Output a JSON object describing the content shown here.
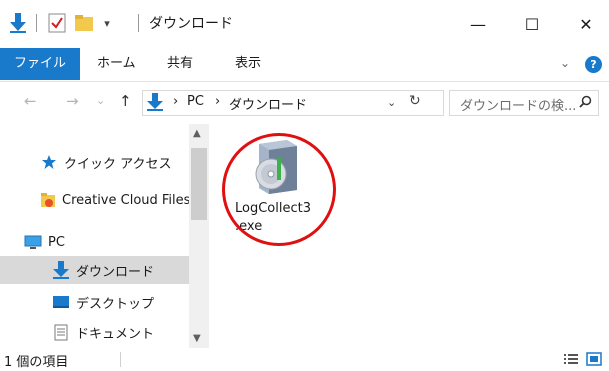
{
  "window": {
    "title": "ダウンロード",
    "minimize_glyph": "—",
    "maximize_glyph": "☐",
    "close_glyph": "✕",
    "accent_color": "#1979ca",
    "folder_color": "#f2c94c"
  },
  "ribbon": {
    "tabs": [
      {
        "label": "ファイル"
      },
      {
        "label": "ホーム"
      },
      {
        "label": "共有"
      },
      {
        "label": "表示"
      }
    ],
    "expand_glyph": "⌄",
    "help_glyph": "?"
  },
  "address": {
    "crumbs": [
      "PC",
      "ダウンロード"
    ],
    "separator": "›",
    "dropdown_glyph": "⌄",
    "refresh_glyph": "↻"
  },
  "search": {
    "placeholder": "ダウンロードの検..."
  },
  "nav": {
    "back_glyph": "←",
    "forward_glyph": "→",
    "recent_glyph": "⌄",
    "up_glyph": "↑",
    "items": [
      {
        "label": "クイック アクセス",
        "icon": "star-icon"
      },
      {
        "label": "Creative Cloud Files",
        "icon": "creative-cloud-icon"
      },
      {
        "label": "PC",
        "icon": "pc-icon"
      },
      {
        "label": "ダウンロード",
        "icon": "download-arrow-icon",
        "selected": true
      },
      {
        "label": "デスクトップ",
        "icon": "desktop-icon"
      },
      {
        "label": "ドキュメント",
        "icon": "document-icon"
      }
    ],
    "scroll_up_glyph": "▲",
    "scroll_down_glyph": "▼"
  },
  "content": {
    "files": [
      {
        "name": "LogCollect3\n.exe",
        "icon": "installer-package-icon"
      }
    ],
    "highlight_color": "#e11010"
  },
  "status": {
    "item_count": "1 個の項目"
  }
}
